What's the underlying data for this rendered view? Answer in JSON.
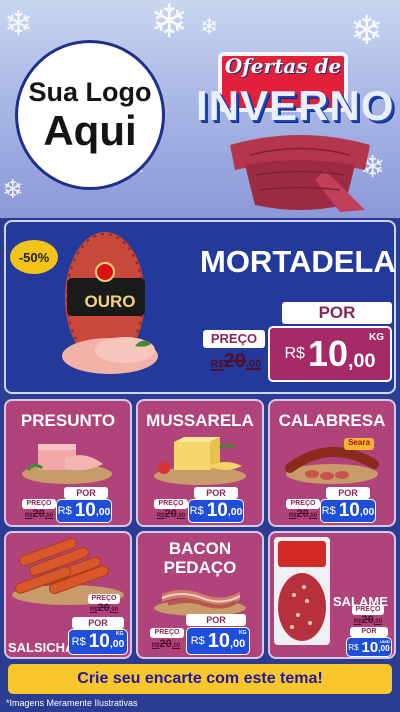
{
  "header": {
    "logo": {
      "line1": "Sua Logo",
      "line2": "Aqui"
    },
    "campaign": {
      "line1": "Ofertas de",
      "line2": "INVERNO"
    }
  },
  "featured": {
    "discount": "-50%",
    "brand": "OURO",
    "name": "MORTADELA",
    "preco_label": "PREÇO",
    "old_price": {
      "currency": "R$",
      "integer": "20",
      "cents": ",00"
    },
    "por_label": "POR",
    "new_price": {
      "currency": "R$",
      "integer": "10",
      "cents": ",00"
    },
    "unit": "KG"
  },
  "products": [
    {
      "name": "PRESUNTO",
      "preco_label": "PREÇO",
      "old_price": {
        "currency": "R$",
        "integer": "20",
        "cents": ",00"
      },
      "por_label": "POR",
      "new_price": {
        "currency": "R$",
        "integer": "10",
        "cents": ",00"
      }
    },
    {
      "name": "MUSSARELA",
      "preco_label": "PREÇO",
      "old_price": {
        "currency": "R$",
        "integer": "20",
        "cents": ",00"
      },
      "por_label": "POR",
      "new_price": {
        "currency": "R$",
        "integer": "10",
        "cents": ",00"
      }
    },
    {
      "name": "CALABRESA",
      "brand": "Seara",
      "preco_label": "PREÇO",
      "old_price": {
        "currency": "R$",
        "integer": "20",
        "cents": ",00"
      },
      "por_label": "POR",
      "new_price": {
        "currency": "R$",
        "integer": "10",
        "cents": ",00"
      }
    },
    {
      "name": "SALSICHA",
      "preco_label": "PREÇO",
      "old_price": {
        "currency": "R$",
        "integer": "20",
        "cents": ",00"
      },
      "por_label": "POR",
      "new_price": {
        "currency": "R$",
        "integer": "10",
        "cents": ",00"
      },
      "unit": "KG"
    },
    {
      "name": "BACON PEDAÇO",
      "name_line1": "BACON",
      "name_line2": "PEDAÇO",
      "preco_label": "PREÇO",
      "old_price": {
        "currency": "R$",
        "integer": "20",
        "cents": ",00"
      },
      "por_label": "POR",
      "new_price": {
        "currency": "R$",
        "integer": "10",
        "cents": ",00"
      },
      "unit": "KG"
    },
    {
      "name": "SALAME",
      "preco_label": "PREÇO",
      "old_price": {
        "currency": "R$",
        "integer": "20",
        "cents": ",00"
      },
      "por_label": "POR",
      "new_price": {
        "currency": "R$",
        "integer": "10",
        "cents": ",00"
      },
      "unit": "UNID"
    }
  ],
  "cta": "Crie seu encarte com este tema!",
  "disclaimer": "*Imagens Meramente Ilustrativas",
  "colors": {
    "header_bg": "#aab8e6",
    "page_bg": "#2a3d92",
    "card_magenta": "#b0437a",
    "card_blue": "#23399b",
    "price_blue": "#1f4fd8",
    "cta_yellow": "#f6c62b",
    "badge_yellow": "#f2c319"
  },
  "icons": [
    "snowflake-icon",
    "scarf-icon",
    "mortadela-image",
    "presunto-image",
    "mussarela-image",
    "calabresa-image",
    "salsicha-image",
    "bacon-image",
    "salame-image"
  ]
}
